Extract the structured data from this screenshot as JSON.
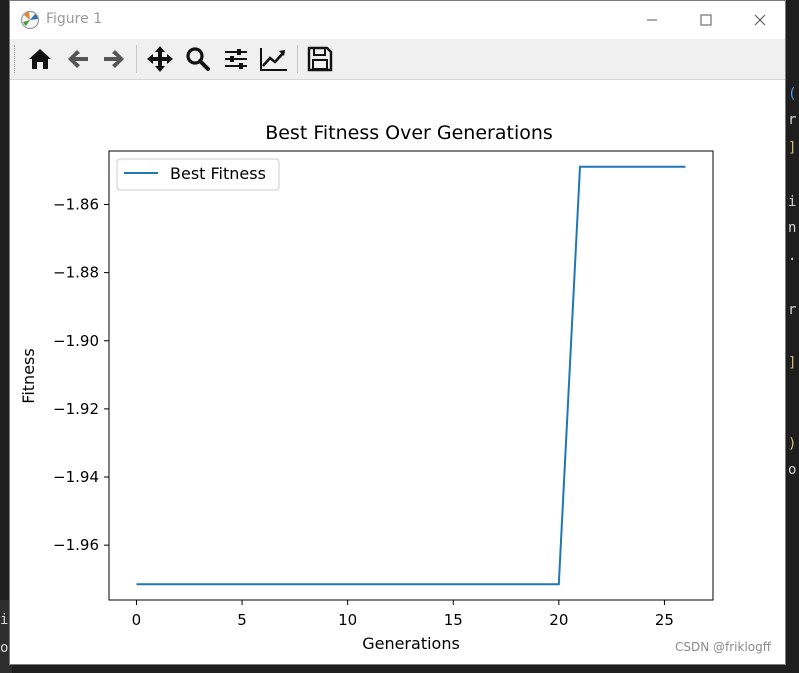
{
  "window": {
    "title": "Figure 1",
    "buttons": {
      "minimize": "minimize",
      "maximize": "maximize",
      "close": "close"
    }
  },
  "toolbar": {
    "items": [
      {
        "icon": "home-icon",
        "name": "home-button"
      },
      {
        "icon": "arrow-left-icon",
        "name": "back-button"
      },
      {
        "icon": "arrow-right-icon",
        "name": "forward-button"
      },
      {
        "icon": "move-icon",
        "name": "pan-button"
      },
      {
        "icon": "magnifier-icon",
        "name": "zoom-button"
      },
      {
        "icon": "sliders-icon",
        "name": "configure-subplots-button"
      },
      {
        "icon": "chart-line-icon",
        "name": "edit-axis-button"
      },
      {
        "icon": "floppy-disk-icon",
        "name": "save-button"
      }
    ]
  },
  "chart_data": {
    "type": "line",
    "title": "Best Fitness Over Generations",
    "xlabel": "Generations",
    "ylabel": "Fitness",
    "xlim": [
      -1.3,
      27.3
    ],
    "ylim": [
      -1.9761,
      -1.8443
    ],
    "xticks": [
      0,
      5,
      10,
      15,
      20,
      25
    ],
    "yticks": [
      -1.96,
      -1.94,
      -1.92,
      -1.9,
      -1.88,
      -1.86
    ],
    "xtick_labels": [
      "0",
      "5",
      "10",
      "15",
      "20",
      "25"
    ],
    "ytick_labels": [
      "−1.96",
      "−1.94",
      "−1.92",
      "−1.90",
      "−1.88",
      "−1.86"
    ],
    "legend": {
      "placement": "upper-left",
      "entries": [
        "Best Fitness"
      ]
    },
    "grid": false,
    "color": "#1f77b4",
    "series": [
      {
        "name": "Best Fitness",
        "x": [
          0,
          1,
          2,
          3,
          4,
          5,
          6,
          7,
          8,
          9,
          10,
          11,
          12,
          13,
          14,
          15,
          16,
          17,
          18,
          19,
          20,
          21,
          22,
          23,
          24,
          25,
          26
        ],
        "y": [
          -1.9715,
          -1.9715,
          -1.9715,
          -1.9715,
          -1.9715,
          -1.9715,
          -1.9715,
          -1.9715,
          -1.9715,
          -1.9715,
          -1.9715,
          -1.9715,
          -1.9715,
          -1.9715,
          -1.9715,
          -1.9715,
          -1.9715,
          -1.9715,
          -1.9715,
          -1.9715,
          -1.9715,
          -1.8489,
          -1.8489,
          -1.8489,
          -1.8489,
          -1.8489,
          -1.8489
        ]
      }
    ]
  },
  "background": {
    "right_fragments": [
      "(",
      "r",
      "]",
      "i",
      "n",
      ".",
      "r",
      "]",
      ")",
      "o"
    ],
    "bottom_fragments": [
      "i",
      "o"
    ]
  },
  "watermark": "CSDN @friklogff"
}
